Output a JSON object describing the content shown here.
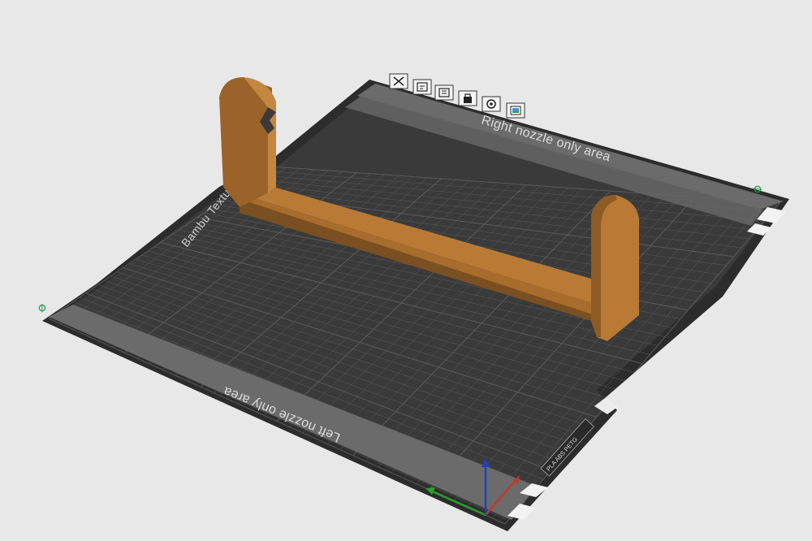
{
  "scene": {
    "background_color": "#e8e8e8",
    "plate_color": "#3a3a3a",
    "grid_color": "#5a5a5a",
    "zone_color": "#6b6b6b",
    "model_color": "#b87a35"
  },
  "plate": {
    "name_label": "Bambu Textured PEI Plate",
    "right_zone_label": "Right nozzle only area",
    "left_zone_label": "Left nozzle only area",
    "filament_label": "PLA ABS PETG"
  },
  "plate_toolbar": {
    "icons": [
      {
        "name": "delete-plate-icon"
      },
      {
        "name": "arrange-icon"
      },
      {
        "name": "orient-icon"
      },
      {
        "name": "lock-icon"
      },
      {
        "name": "plate-settings-icon"
      },
      {
        "name": "preview-icon"
      }
    ]
  },
  "markers": {
    "left_marker": "∅",
    "right_marker": "∅"
  },
  "axes": {
    "x_color": "#c0392b",
    "y_color": "#2ca02c",
    "z_color": "#1f3fbf"
  }
}
